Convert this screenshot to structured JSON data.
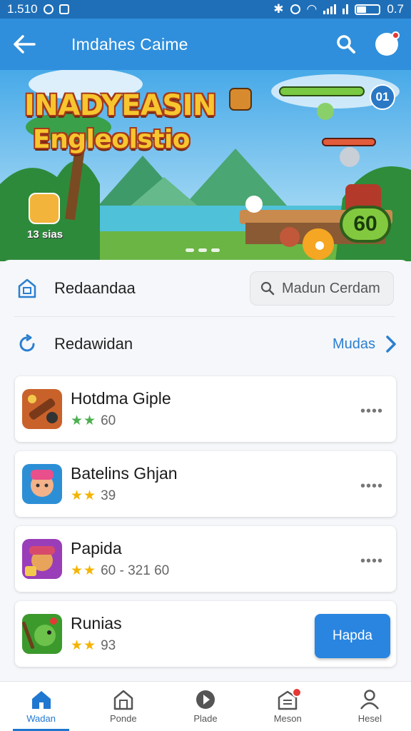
{
  "status_bar": {
    "time": "1.510",
    "right_value": "0.7"
  },
  "app_bar": {
    "title": "Imdahes Caime"
  },
  "banner": {
    "headline_line1": "INADYEASIN",
    "headline_line2": "Engleolstio",
    "tag": "13 sias",
    "level": "01",
    "badge": "60"
  },
  "section1": {
    "label": "Redaandaa",
    "search_placeholder": "Madun Cerdam"
  },
  "section2": {
    "label": "Redawidan",
    "link": "Mudas"
  },
  "games": [
    {
      "name": "Hotdma Giple",
      "stars": "★★",
      "rating": "60",
      "action": "••••",
      "icon_color": "#c9622a"
    },
    {
      "name": "Batelins Ghjan",
      "stars": "★★",
      "rating": "39",
      "action": "••••",
      "icon_color": "#2c8fd6"
    },
    {
      "name": "Papida",
      "stars": "★★",
      "rating": "60 - 321 60",
      "action": "••••",
      "icon_color": "#9a3db8"
    },
    {
      "name": "Runias",
      "stars": "★★",
      "rating": "93",
      "action": "Hapda",
      "icon_color": "#3c9a2d"
    }
  ],
  "bottom_nav": [
    {
      "label": "Wadan",
      "icon": "home-icon"
    },
    {
      "label": "Ponde",
      "icon": "store-icon"
    },
    {
      "label": "Plade",
      "icon": "play-icon"
    },
    {
      "label": "Meson",
      "icon": "inbox-icon"
    },
    {
      "label": "Hesel",
      "icon": "profile-icon"
    }
  ]
}
